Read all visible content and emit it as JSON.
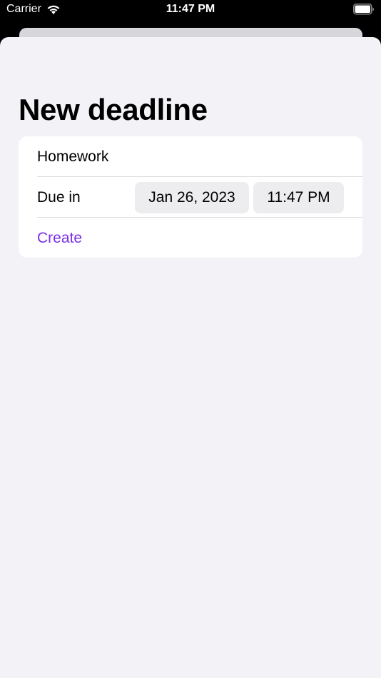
{
  "status_bar": {
    "carrier": "Carrier",
    "time": "11:47 PM",
    "icons": [
      "wifi-icon",
      "battery-icon"
    ]
  },
  "sheet": {
    "title": "New deadline"
  },
  "form": {
    "title_value": "Homework",
    "due_label": "Due in",
    "date_value": "Jan 26, 2023",
    "time_value": "11:47 PM",
    "create_label": "Create"
  },
  "colors": {
    "accent": "#7b2fe8",
    "background": "#f2f2f7",
    "card": "#ffffff",
    "pill": "#ededef",
    "status_bar": "#000000"
  }
}
